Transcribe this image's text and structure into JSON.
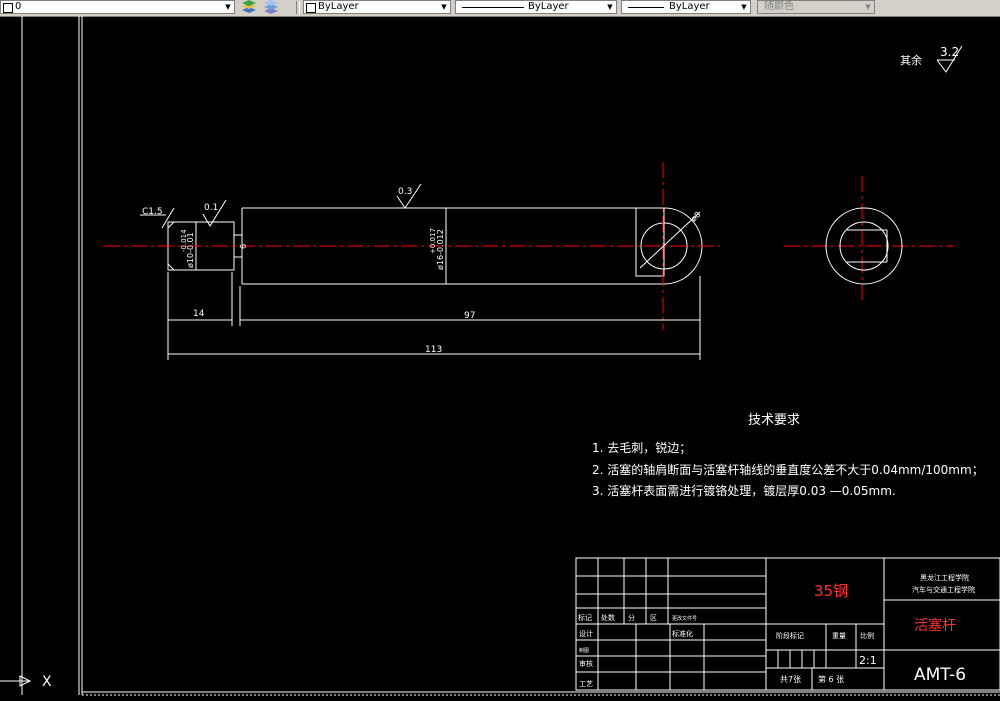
{
  "toolbar": {
    "layer": "0",
    "color": "ByLayer",
    "linetype": "ByLayer",
    "lineweight": "ByLayer",
    "plotstyle": "随颜色"
  },
  "drawing": {
    "roughness_other": "其余",
    "roughness_value": "3.2",
    "chamfer": "C1.5",
    "roughness_small": "0.1",
    "roughness_rod": "0.3",
    "dia_small": "ø10-0.01",
    "dia_small_tol": "-0.014",
    "dia_rod": "ø16-0.012",
    "dia_rod_tol": "+0.017",
    "dim_6": "6",
    "dia_hole": "ø8",
    "dim_14": "14",
    "dim_97": "97",
    "dim_113": "113"
  },
  "requirements": {
    "title": "技术要求",
    "item1": "1. 去毛刺，锐边；",
    "item2": "2. 活塞的轴肩断面与活塞杆轴线的垂直度公差不大于0.04mm/100mm；",
    "item3": "3. 活塞杆表面需进行镀铬处理，镀层厚0.03 —0.05mm."
  },
  "title_block": {
    "material": "35钢",
    "school": "黑龙江工程学院",
    "college": "汽车与交通工程学院",
    "part_name": "活塞杆",
    "drawing_no": "AMT-6",
    "scale": "2:1",
    "stage_label": "阶段标记",
    "weight_label": "重量",
    "scale_label": "比例",
    "sheets_label": "共7张",
    "sheet_label": "第 6 张",
    "mark": "标记",
    "count": "处数",
    "zone": "分",
    "region": "区",
    "change_doc": "更改文件号",
    "design": "设计",
    "standardize": "标准化",
    "drawer": "制图",
    "review": "审核",
    "process": "工艺"
  },
  "ucs": {
    "x_label": "X"
  },
  "colors": {
    "center_line": "#ff0000",
    "outline": "#ffffff",
    "red_text": "#ff3030"
  }
}
